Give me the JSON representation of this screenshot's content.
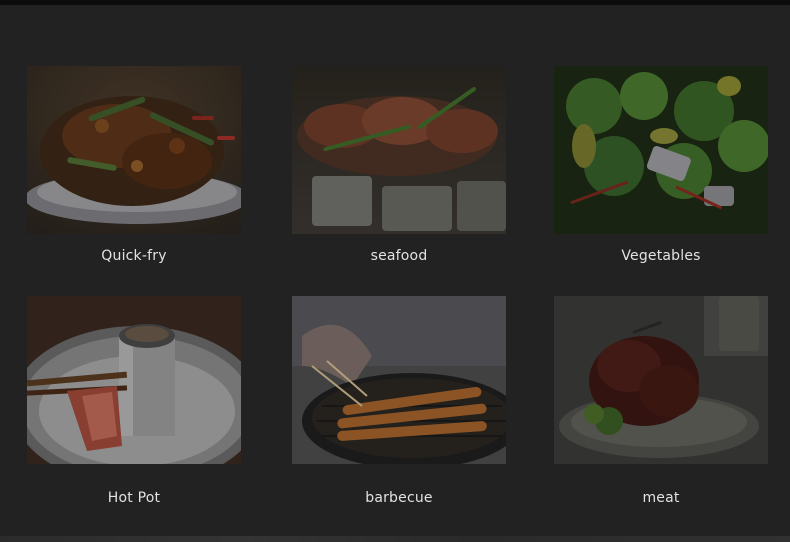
{
  "categories": [
    {
      "label": "Quick-fry",
      "icon": "stir-fry-dish-image"
    },
    {
      "label": "seafood",
      "icon": "seafood-dish-image"
    },
    {
      "label": "Vegetables",
      "icon": "vegetable-salad-image"
    },
    {
      "label": "Hot Pot",
      "icon": "hot-pot-image"
    },
    {
      "label": "barbecue",
      "icon": "barbecue-skewers-image"
    },
    {
      "label": "meat",
      "icon": "braised-meat-image"
    }
  ],
  "colors": {
    "background": "#222222",
    "caption_text": "#e2e2e2"
  }
}
